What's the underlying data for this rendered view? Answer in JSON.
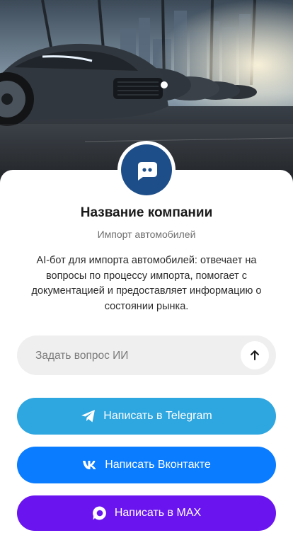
{
  "hero": {
    "image": "car-showroom-photo"
  },
  "company": {
    "avatar_icon": "chat-bot-icon",
    "name": "Название компании",
    "subtitle": "Импорт автомобилей",
    "description": "AI-бот для импорта автомобилей: отвечает на вопросы по процессу импорта, помогает с документацией и предоставляет информацию о состоянии рынка."
  },
  "ask": {
    "placeholder": "Задать вопрос ИИ",
    "value": "",
    "send_icon": "arrow-up-icon"
  },
  "buttons": {
    "telegram": {
      "label": "Написать в Telegram",
      "icon": "telegram-icon",
      "color": "#2ea6e0"
    },
    "vk": {
      "label": "Написать Вконтакте",
      "icon": "vk-icon",
      "color": "#0a7cff"
    },
    "max": {
      "label": "Написать в MAX",
      "icon": "max-icon",
      "color": "#6a14f0"
    }
  }
}
